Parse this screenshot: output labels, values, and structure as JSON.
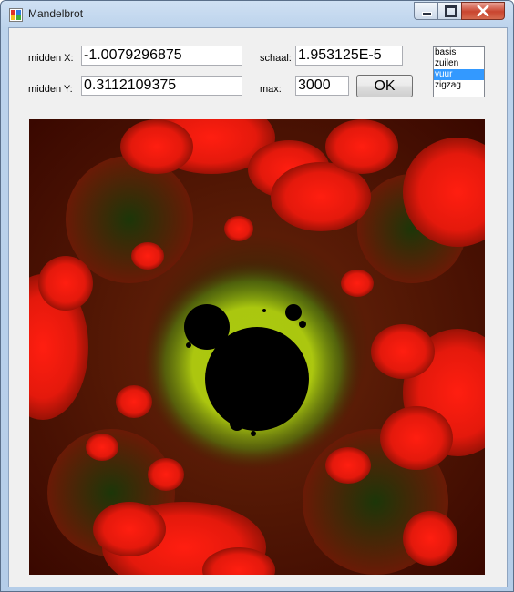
{
  "window": {
    "title": "Mandelbrot"
  },
  "controls": {
    "midden_x": {
      "label": "midden X:",
      "value": "-1.0079296875"
    },
    "midden_y": {
      "label": "midden Y:",
      "value": "0.3112109375"
    },
    "schaal": {
      "label": "schaal:",
      "value": "1.953125E-5"
    },
    "max": {
      "label": "max:",
      "value": "3000"
    },
    "ok_label": "OK"
  },
  "palette_list": {
    "items": [
      "basis",
      "zuilen",
      "vuur",
      "zigzag"
    ],
    "selected": "vuur"
  },
  "colors": {
    "selection": "#3399ff",
    "fractal_outer": "#4a0c00",
    "fractal_red": "#e81a0f",
    "fractal_edge": "#b6d40a",
    "fractal_inside": "#000000"
  },
  "icons": [
    "app-icon",
    "minimize-icon",
    "maximize-icon",
    "close-icon"
  ]
}
